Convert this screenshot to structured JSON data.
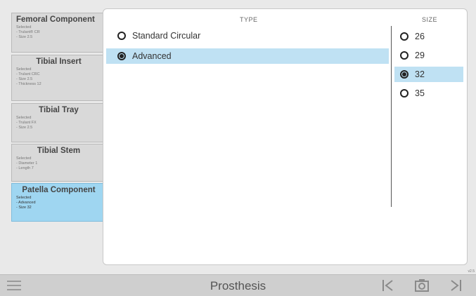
{
  "components": [
    {
      "title": "Femoral Component",
      "lines": [
        "Selected",
        "- Trulant® CR",
        "- Size 2.5"
      ]
    },
    {
      "title": "Tibial Insert",
      "lines": [
        "Selected",
        "- Trulant CRC",
        "- Size 2.5",
        "- Thickness 12"
      ]
    },
    {
      "title": "Tibial Tray",
      "lines": [
        "Selected",
        "- Trulant FX",
        "- Size 2.5"
      ]
    },
    {
      "title": "Tibial Stem",
      "lines": [
        "Selected",
        "- Diameter 1",
        "- Length 7"
      ]
    },
    {
      "title": "Patella Component",
      "lines": [
        "Selected",
        "- Advanced",
        "- Size 32"
      ]
    }
  ],
  "active_component": "Patella Component",
  "type": {
    "header": "TYPE",
    "options": [
      {
        "label": "Standard Circular",
        "selected": false
      },
      {
        "label": "Advanced",
        "selected": true
      }
    ]
  },
  "size": {
    "header": "SIZE",
    "options": [
      {
        "label": "26",
        "selected": false
      },
      {
        "label": "29",
        "selected": false
      },
      {
        "label": "32",
        "selected": true
      },
      {
        "label": "35",
        "selected": false
      }
    ]
  },
  "version": "v2.5",
  "bottom_bar": {
    "title": "Prosthesis",
    "icons": [
      "menu-icon",
      "skip-back-icon",
      "camera-icon",
      "skip-forward-icon"
    ]
  },
  "colors": {
    "selected_bg": "#bfe1f3",
    "active_component_bg": "#9fd6f1"
  }
}
